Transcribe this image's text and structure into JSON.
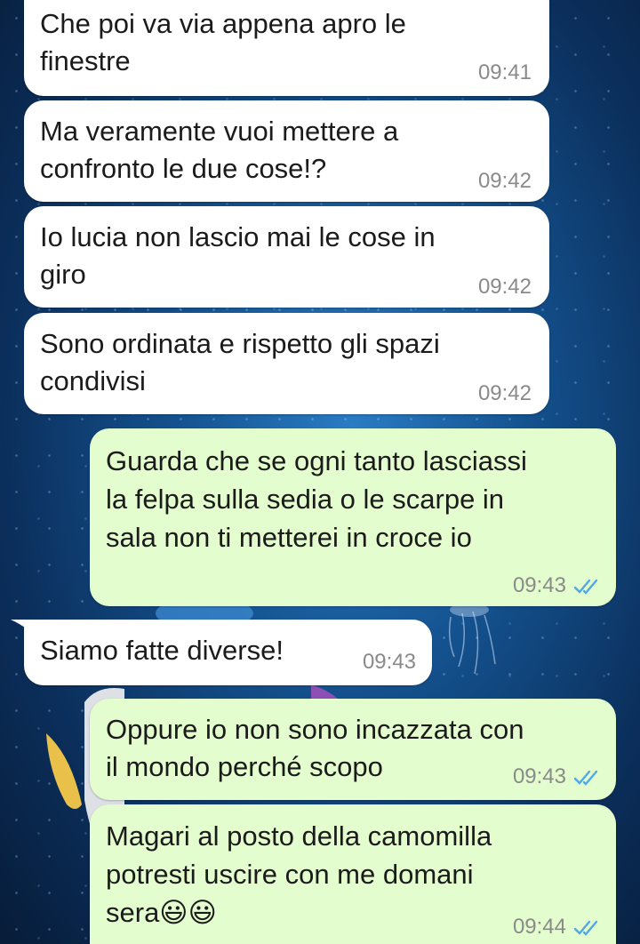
{
  "messages": [
    {
      "direction": "incoming",
      "lines": [
        "Che poi va via appena apro le",
        "finestre"
      ],
      "time": "09:41"
    },
    {
      "direction": "incoming",
      "lines": [
        "Ma veramente vuoi mettere a",
        "confronto le due cose!?"
      ],
      "time": "09:42"
    },
    {
      "direction": "incoming",
      "lines": [
        "Io lucia non lascio mai le cose in",
        "giro"
      ],
      "time": "09:42"
    },
    {
      "direction": "incoming",
      "lines": [
        "Sono ordinata e rispetto gli spazi",
        "condivisi"
      ],
      "time": "09:42"
    },
    {
      "direction": "outgoing",
      "lines": [
        "Guarda che se ogni tanto lasciassi",
        "la felpa sulla sedia o le scarpe in",
        "sala non ti metterei in croce io"
      ],
      "time": "09:43",
      "status": "read"
    },
    {
      "direction": "incoming",
      "lines": [
        "Siamo fatte diverse!"
      ],
      "time": "09:43"
    },
    {
      "direction": "outgoing",
      "lines": [
        "Oppure io non sono incazzata con",
        "il mondo perché scopo"
      ],
      "time": "09:43",
      "status": "read"
    },
    {
      "direction": "outgoing",
      "lines": [
        "Magari al posto della camomilla",
        "potresti uscire con me domani",
        "sera😃😃"
      ],
      "time": "09:44",
      "status": "read"
    }
  ],
  "colors": {
    "incoming_bubble": "#ffffff",
    "outgoing_bubble": "#e4fdce",
    "read_ticks": "#4fa8e8",
    "timestamp": "#8a8a8a"
  },
  "icons": {
    "read_status": "double-check-icon",
    "emoji": "grinning-face-emoji"
  }
}
